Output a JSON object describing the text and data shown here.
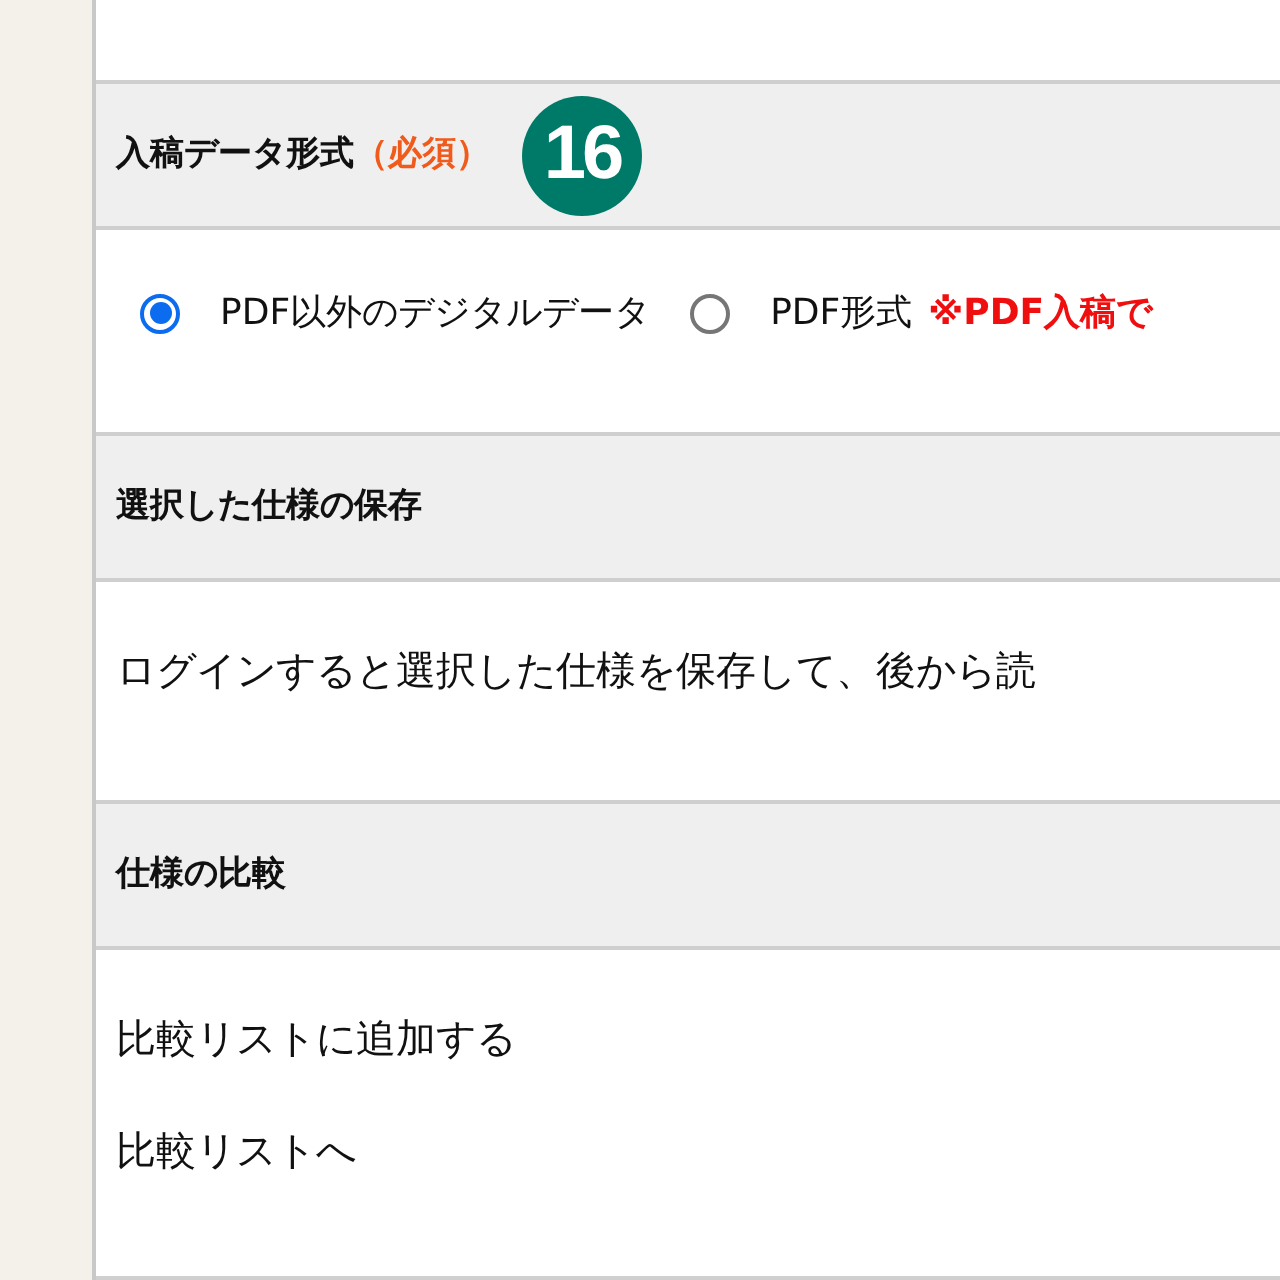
{
  "sections": [
    {
      "kind": "radios",
      "title": "入稿データ形式",
      "required": "（必須）",
      "badge": "16",
      "options": [
        {
          "label": "PDF以外のデジタルデータ",
          "selected": true
        },
        {
          "label": "PDF形式",
          "selected": false
        }
      ],
      "note": "※PDF入稿で"
    },
    {
      "kind": "text",
      "title": "選択した仕様の保存",
      "lines": [
        "ログインすると選択した仕様を保存して、後から読"
      ]
    },
    {
      "kind": "text",
      "title": "仕様の比較",
      "lines": [
        "比較リストに追加する",
        "比較リストへ"
      ]
    }
  ]
}
